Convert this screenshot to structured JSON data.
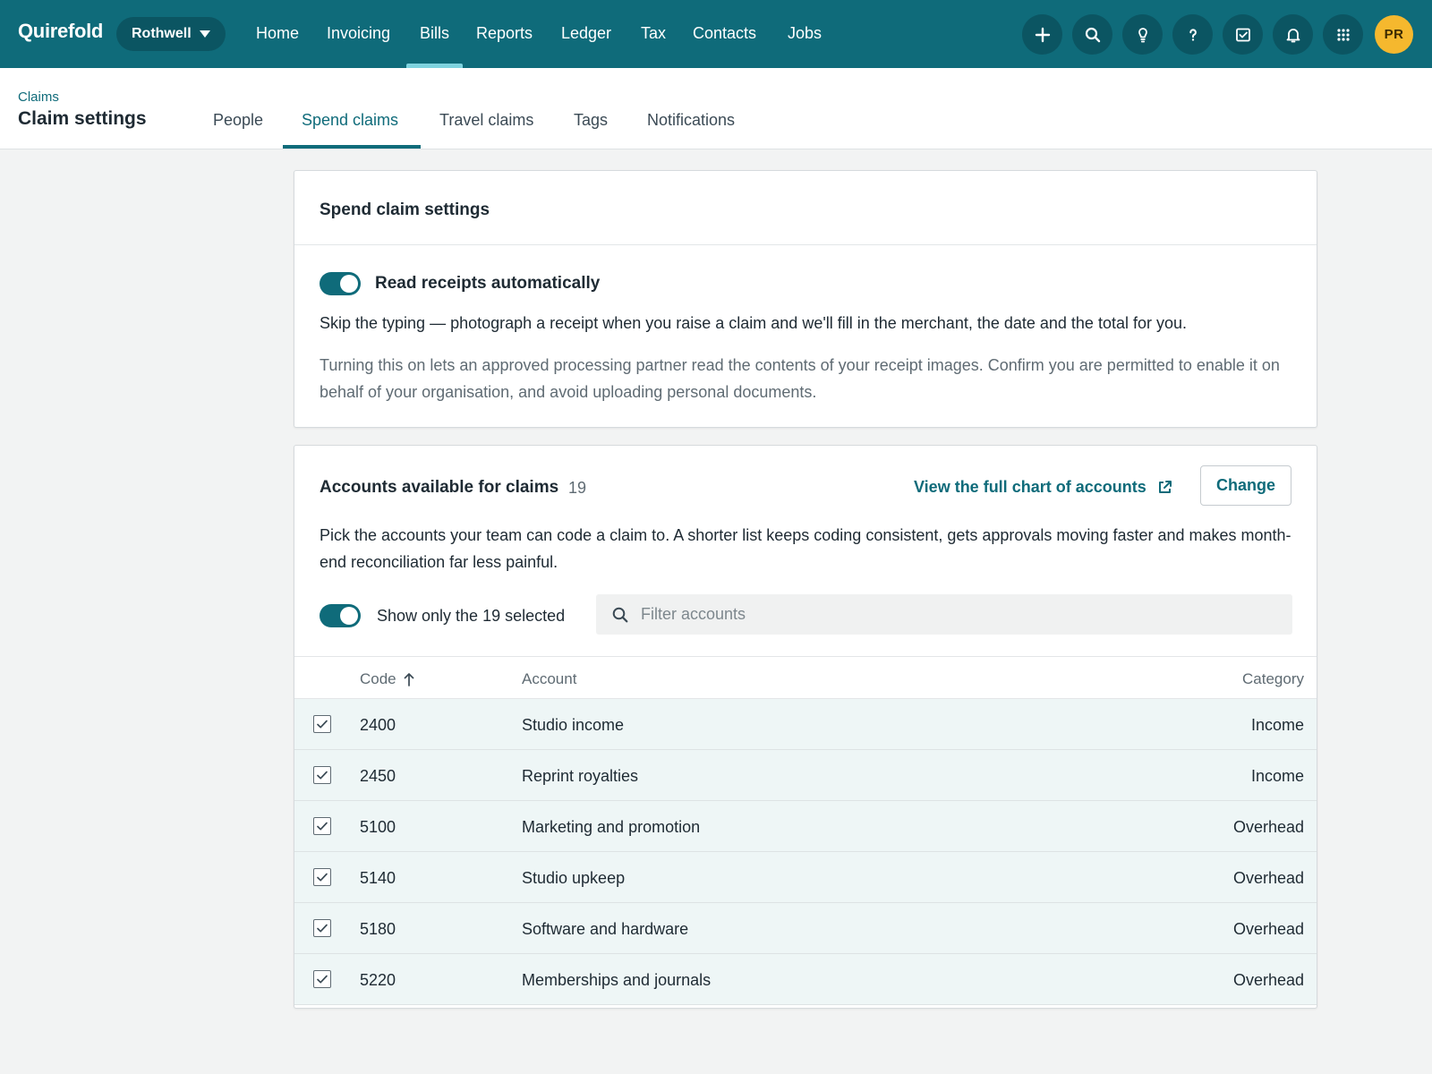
{
  "app": {
    "brand": "Quirefold",
    "org": "Rothwell",
    "nav": [
      "Home",
      "Invoicing",
      "Bills",
      "Reports",
      "Ledger",
      "Tax",
      "Contacts",
      "Jobs"
    ],
    "active_nav": "Bills",
    "icons": [
      "plus-icon",
      "search-icon",
      "lightbulb-icon",
      "help-icon",
      "tasks-icon",
      "bell-icon",
      "apps-grid-icon"
    ],
    "avatar_initials": "PR"
  },
  "subheader": {
    "breadcrumb": "Claims",
    "title": "Claim settings",
    "tabs": [
      "People",
      "Spend claims",
      "Travel claims",
      "Tags",
      "Notifications"
    ],
    "active_tab": "Spend claims"
  },
  "spend_settings": {
    "title": "Spend claim settings",
    "toggle_label": "Read receipts automatically",
    "toggle_on": true,
    "description": "Skip the typing — photograph a receipt when you raise a claim and we'll fill in the merchant, the date and the total for you.",
    "note": "Turning this on lets an approved processing partner read the contents of your receipt images. Confirm you are permitted to enable it on behalf of your organisation, and avoid uploading personal documents."
  },
  "accounts": {
    "title": "Accounts available for claims",
    "count": "19",
    "chart_link": "View the full chart of accounts",
    "change_button": "Change",
    "description": "Pick the accounts your team can code a claim to. A shorter list keeps coding consistent, gets approvals moving faster and makes month-end reconciliation far less painful.",
    "show_selected_label": "Show only the 19 selected",
    "show_selected_on": true,
    "filter_placeholder": "Filter accounts",
    "columns": {
      "code": "Code",
      "account": "Account",
      "category": "Category"
    },
    "rows": [
      {
        "code": "2400",
        "account": "Studio income",
        "category": "Income",
        "checked": true
      },
      {
        "code": "2450",
        "account": "Reprint royalties",
        "category": "Income",
        "checked": true
      },
      {
        "code": "5100",
        "account": "Marketing and promotion",
        "category": "Overhead",
        "checked": true
      },
      {
        "code": "5140",
        "account": "Studio upkeep",
        "category": "Overhead",
        "checked": true
      },
      {
        "code": "5180",
        "account": "Software and hardware",
        "category": "Overhead",
        "checked": true
      },
      {
        "code": "5220",
        "account": "Memberships and journals",
        "category": "Overhead",
        "checked": true
      }
    ]
  },
  "colors": {
    "brand": "#0f6b7a",
    "brand_dark": "#0b5562",
    "avatar": "#f5b82e",
    "row_highlight": "#eef6f6"
  }
}
